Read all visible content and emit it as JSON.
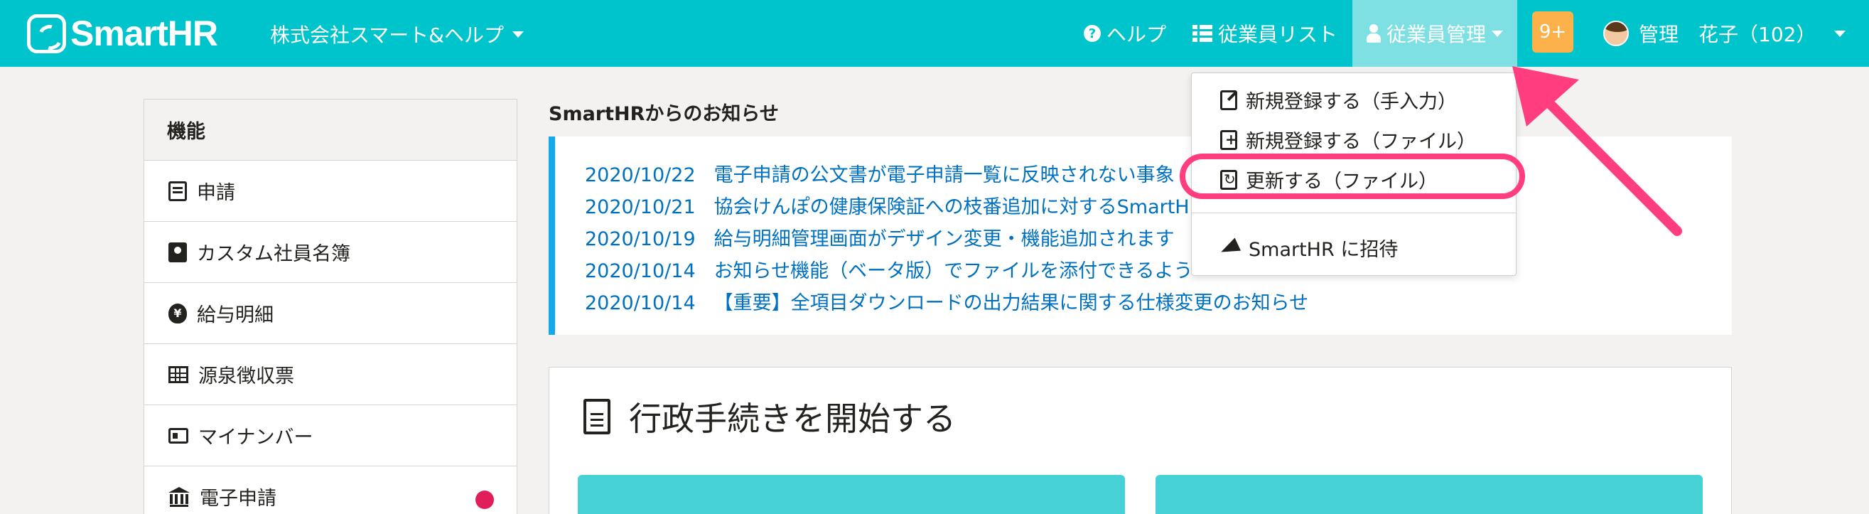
{
  "header": {
    "logo_text": "SmartHR",
    "company": "株式会社スマート&ヘルプ",
    "nav": {
      "help": "ヘルプ",
      "employee_list": "従業員リスト",
      "employee_manage": "従業員管理"
    },
    "badge": "9+",
    "user": "管理　花子（102）"
  },
  "sidebar": {
    "title": "機能",
    "items": [
      {
        "label": "申請",
        "icon": "application-icon"
      },
      {
        "label": "カスタム社員名簿",
        "icon": "roster-icon"
      },
      {
        "label": "給与明細",
        "icon": "payslip-icon"
      },
      {
        "label": "源泉徴収票",
        "icon": "withholding-icon"
      },
      {
        "label": "マイナンバー",
        "icon": "id-card-icon"
      },
      {
        "label": "電子申請",
        "icon": "bank-icon",
        "has_alert": true
      }
    ]
  },
  "notices": {
    "title": "SmartHRからのお知らせ",
    "items": [
      {
        "date": "2020/10/22",
        "text": "電子申請の公文書が電子申請一覧に反映されない事象"
      },
      {
        "date": "2020/10/21",
        "text": "協会けんぽの健康保険証への枝番追加に対するSmartHR"
      },
      {
        "date": "2020/10/19",
        "text": "給与明細管理画面がデザイン変更・機能追加されます"
      },
      {
        "date": "2020/10/14",
        "text": "お知らせ機能（ベータ版）でファイルを添付できるよう"
      },
      {
        "date": "2020/10/14",
        "text": "【重要】全項目ダウンロードの出力結果に関する仕様変更のお知らせ"
      }
    ]
  },
  "main": {
    "title": "行政手続きを開始する"
  },
  "dropdown": {
    "items": [
      {
        "label": "新規登録する（手入力）"
      },
      {
        "label": "新規登録する（ファイル）"
      },
      {
        "label": "更新する（ファイル）"
      },
      {
        "label": "SmartHR に招待"
      }
    ]
  },
  "colors": {
    "header": "#00c4cc",
    "active_nav": "#7fe0e4",
    "badge": "#fdb14a",
    "link": "#0071c1",
    "notice_accent": "#14a9ec",
    "annotation": "#ff3d7f",
    "alert_dot": "#e01e5a"
  }
}
